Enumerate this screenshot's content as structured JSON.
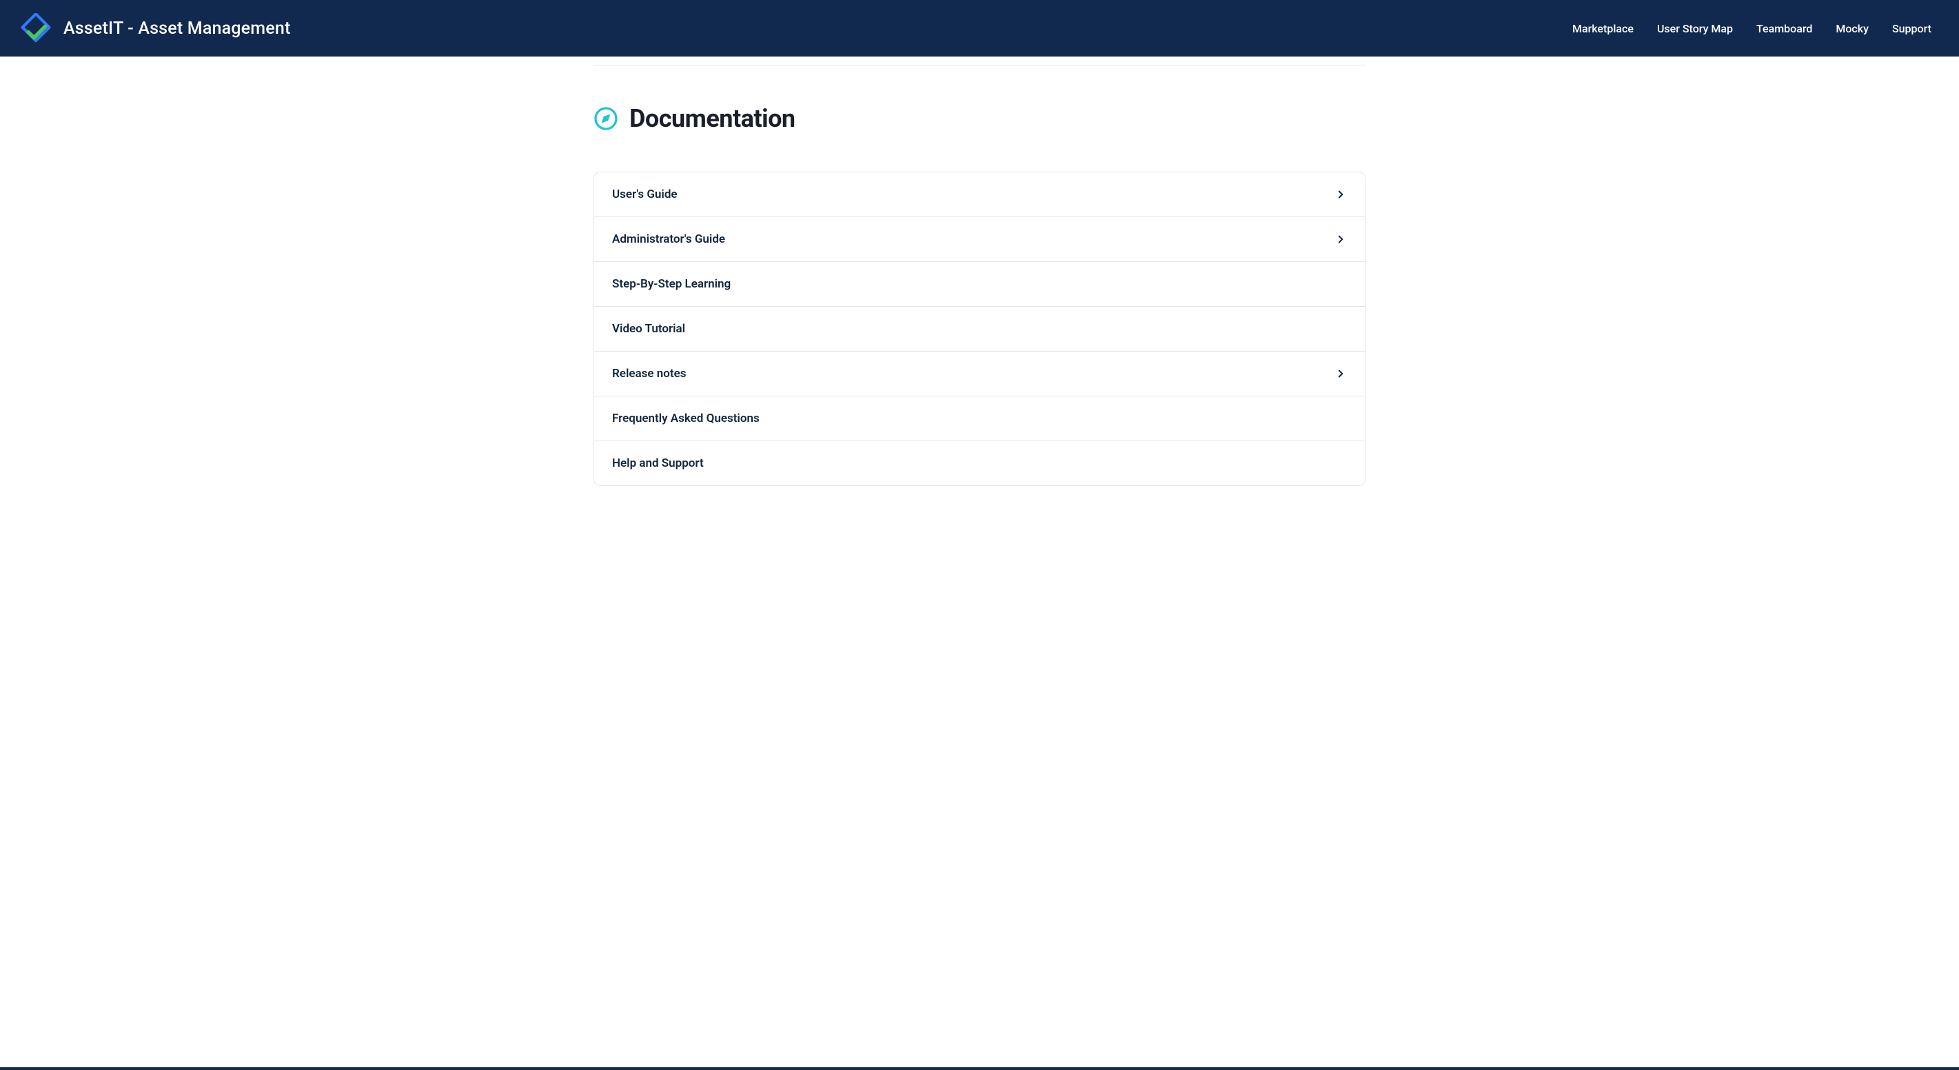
{
  "header": {
    "app_title": "AssetIT - Asset Management",
    "nav": [
      {
        "label": "Marketplace"
      },
      {
        "label": "User Story Map"
      },
      {
        "label": "Teamboard"
      },
      {
        "label": "Mocky"
      },
      {
        "label": "Support"
      }
    ]
  },
  "page": {
    "title": "Documentation"
  },
  "docs": {
    "items": [
      {
        "label": "User's Guide",
        "has_children": true
      },
      {
        "label": "Administrator's Guide",
        "has_children": true
      },
      {
        "label": "Step-By-Step Learning",
        "has_children": false
      },
      {
        "label": "Video Tutorial",
        "has_children": false
      },
      {
        "label": "Release notes",
        "has_children": true
      },
      {
        "label": "Frequently Asked Questions",
        "has_children": false
      },
      {
        "label": "Help and Support",
        "has_children": false
      }
    ]
  },
  "colors": {
    "brand_navy": "#12294f",
    "accent_cyan": "#22c3d6",
    "text_primary": "#12263f",
    "border": "#e2e5e9"
  }
}
